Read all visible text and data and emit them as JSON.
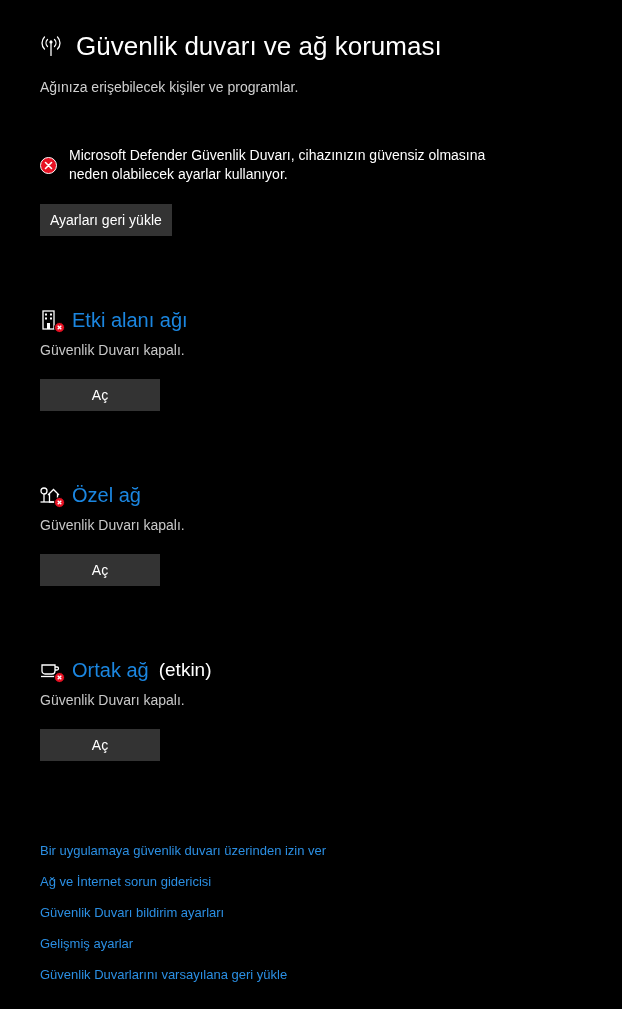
{
  "header": {
    "title": "Güvenlik duvarı ve ağ koruması",
    "subtitle": "Ağınıza erişebilecek kişiler ve programlar."
  },
  "alert": {
    "kind": "error",
    "message": "Microsoft Defender Güvenlik Duvarı, cihazınızın güvensiz olmasına neden olabilecek ayarlar kullanıyor.",
    "button": "Ayarları geri yükle"
  },
  "networks": [
    {
      "kind": "domain",
      "name": "Etki alanı ağı",
      "firewall_on": false,
      "status": "Güvenlik Duvarı kapalı.",
      "button": "Aç"
    },
    {
      "kind": "private",
      "name": "Özel ağ",
      "firewall_on": false,
      "status": "Güvenlik Duvarı kapalı.",
      "button": "Aç"
    },
    {
      "kind": "public",
      "name": "Ortak ağ",
      "active_label": "(etkin)",
      "firewall_on": false,
      "status": "Güvenlik Duvarı kapalı.",
      "button": "Aç"
    }
  ],
  "links": [
    "Bir uygulamaya güvenlik duvarı üzerinden izin ver",
    "Ağ ve İnternet sorun gidericisi",
    "Güvenlik Duvarı bildirim ayarları",
    "Gelişmiş ayarlar",
    "Güvenlik Duvarlarını varsayılana geri yükle"
  ]
}
